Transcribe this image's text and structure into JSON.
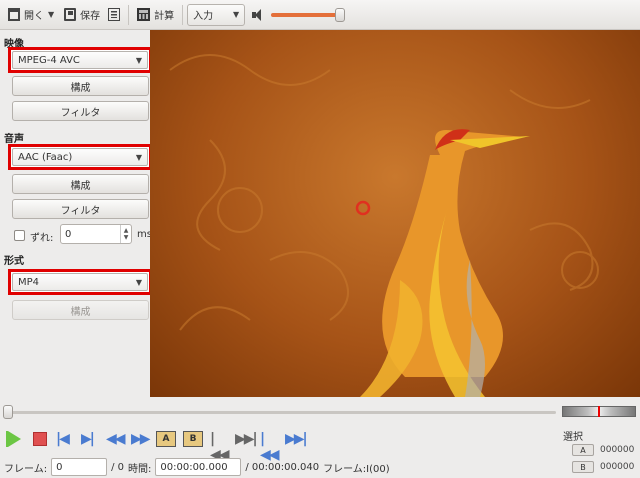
{
  "toolbar": {
    "open_label": "開く",
    "save_label": "保存",
    "calculate_label": "計算",
    "input_combo_value": "入力",
    "volume_percent": 90
  },
  "video": {
    "section_label": "映像",
    "codec": "MPEG-4 AVC",
    "configure_label": "構成",
    "filter_label": "フィルタ"
  },
  "audio": {
    "section_label": "音声",
    "codec": "AAC (Faac)",
    "configure_label": "構成",
    "filter_label": "フィルタ",
    "shift_label": "ずれ:",
    "shift_value": "0",
    "shift_unit": "ms"
  },
  "format": {
    "section_label": "形式",
    "container": "MP4",
    "configure_label": "構成"
  },
  "transport": {
    "marker_a": "A",
    "marker_b": "B"
  },
  "status": {
    "frame_label": "フレーム:",
    "frame_value": "0",
    "frame_total": "/ 0",
    "time_label": "時間:",
    "time_value": "00:00:00.000",
    "duration": "/ 00:00:00.040",
    "frame_type": "フレーム:I(00)"
  },
  "selection": {
    "label": "選択",
    "a_label": "A",
    "a_value": "000000",
    "b_label": "B",
    "b_value": "000000"
  },
  "colors": {
    "highlight_border": "#e00000",
    "volume_fill": "#e46f3a",
    "video_background": "#a65317"
  }
}
